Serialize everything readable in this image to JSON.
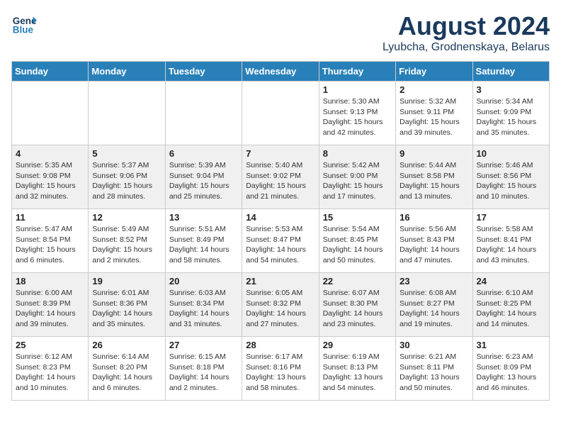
{
  "header": {
    "logo_line1": "General",
    "logo_line2": "Blue",
    "month_title": "August 2024",
    "location": "Lyubcha, Grodnenskaya, Belarus"
  },
  "weekdays": [
    "Sunday",
    "Monday",
    "Tuesday",
    "Wednesday",
    "Thursday",
    "Friday",
    "Saturday"
  ],
  "weeks": [
    [
      {
        "day": "",
        "info": ""
      },
      {
        "day": "",
        "info": ""
      },
      {
        "day": "",
        "info": ""
      },
      {
        "day": "",
        "info": ""
      },
      {
        "day": "1",
        "info": "Sunrise: 5:30 AM\nSunset: 9:13 PM\nDaylight: 15 hours\nand 42 minutes."
      },
      {
        "day": "2",
        "info": "Sunrise: 5:32 AM\nSunset: 9:11 PM\nDaylight: 15 hours\nand 39 minutes."
      },
      {
        "day": "3",
        "info": "Sunrise: 5:34 AM\nSunset: 9:09 PM\nDaylight: 15 hours\nand 35 minutes."
      }
    ],
    [
      {
        "day": "4",
        "info": "Sunrise: 5:35 AM\nSunset: 9:08 PM\nDaylight: 15 hours\nand 32 minutes."
      },
      {
        "day": "5",
        "info": "Sunrise: 5:37 AM\nSunset: 9:06 PM\nDaylight: 15 hours\nand 28 minutes."
      },
      {
        "day": "6",
        "info": "Sunrise: 5:39 AM\nSunset: 9:04 PM\nDaylight: 15 hours\nand 25 minutes."
      },
      {
        "day": "7",
        "info": "Sunrise: 5:40 AM\nSunset: 9:02 PM\nDaylight: 15 hours\nand 21 minutes."
      },
      {
        "day": "8",
        "info": "Sunrise: 5:42 AM\nSunset: 9:00 PM\nDaylight: 15 hours\nand 17 minutes."
      },
      {
        "day": "9",
        "info": "Sunrise: 5:44 AM\nSunset: 8:58 PM\nDaylight: 15 hours\nand 13 minutes."
      },
      {
        "day": "10",
        "info": "Sunrise: 5:46 AM\nSunset: 8:56 PM\nDaylight: 15 hours\nand 10 minutes."
      }
    ],
    [
      {
        "day": "11",
        "info": "Sunrise: 5:47 AM\nSunset: 8:54 PM\nDaylight: 15 hours\nand 6 minutes."
      },
      {
        "day": "12",
        "info": "Sunrise: 5:49 AM\nSunset: 8:52 PM\nDaylight: 15 hours\nand 2 minutes."
      },
      {
        "day": "13",
        "info": "Sunrise: 5:51 AM\nSunset: 8:49 PM\nDaylight: 14 hours\nand 58 minutes."
      },
      {
        "day": "14",
        "info": "Sunrise: 5:53 AM\nSunset: 8:47 PM\nDaylight: 14 hours\nand 54 minutes."
      },
      {
        "day": "15",
        "info": "Sunrise: 5:54 AM\nSunset: 8:45 PM\nDaylight: 14 hours\nand 50 minutes."
      },
      {
        "day": "16",
        "info": "Sunrise: 5:56 AM\nSunset: 8:43 PM\nDaylight: 14 hours\nand 47 minutes."
      },
      {
        "day": "17",
        "info": "Sunrise: 5:58 AM\nSunset: 8:41 PM\nDaylight: 14 hours\nand 43 minutes."
      }
    ],
    [
      {
        "day": "18",
        "info": "Sunrise: 6:00 AM\nSunset: 8:39 PM\nDaylight: 14 hours\nand 39 minutes."
      },
      {
        "day": "19",
        "info": "Sunrise: 6:01 AM\nSunset: 8:36 PM\nDaylight: 14 hours\nand 35 minutes."
      },
      {
        "day": "20",
        "info": "Sunrise: 6:03 AM\nSunset: 8:34 PM\nDaylight: 14 hours\nand 31 minutes."
      },
      {
        "day": "21",
        "info": "Sunrise: 6:05 AM\nSunset: 8:32 PM\nDaylight: 14 hours\nand 27 minutes."
      },
      {
        "day": "22",
        "info": "Sunrise: 6:07 AM\nSunset: 8:30 PM\nDaylight: 14 hours\nand 23 minutes."
      },
      {
        "day": "23",
        "info": "Sunrise: 6:08 AM\nSunset: 8:27 PM\nDaylight: 14 hours\nand 19 minutes."
      },
      {
        "day": "24",
        "info": "Sunrise: 6:10 AM\nSunset: 8:25 PM\nDaylight: 14 hours\nand 14 minutes."
      }
    ],
    [
      {
        "day": "25",
        "info": "Sunrise: 6:12 AM\nSunset: 8:23 PM\nDaylight: 14 hours\nand 10 minutes."
      },
      {
        "day": "26",
        "info": "Sunrise: 6:14 AM\nSunset: 8:20 PM\nDaylight: 14 hours\nand 6 minutes."
      },
      {
        "day": "27",
        "info": "Sunrise: 6:15 AM\nSunset: 8:18 PM\nDaylight: 14 hours\nand 2 minutes."
      },
      {
        "day": "28",
        "info": "Sunrise: 6:17 AM\nSunset: 8:16 PM\nDaylight: 13 hours\nand 58 minutes."
      },
      {
        "day": "29",
        "info": "Sunrise: 6:19 AM\nSunset: 8:13 PM\nDaylight: 13 hours\nand 54 minutes."
      },
      {
        "day": "30",
        "info": "Sunrise: 6:21 AM\nSunset: 8:11 PM\nDaylight: 13 hours\nand 50 minutes."
      },
      {
        "day": "31",
        "info": "Sunrise: 6:23 AM\nSunset: 8:09 PM\nDaylight: 13 hours\nand 46 minutes."
      }
    ]
  ]
}
